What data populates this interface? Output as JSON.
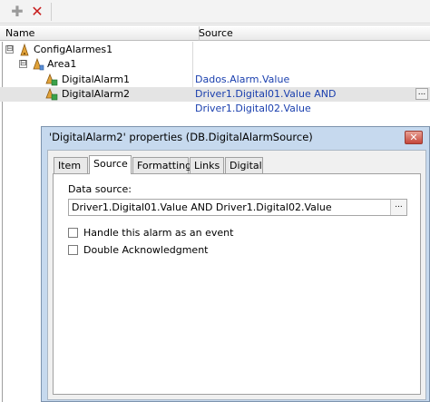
{
  "toolbar": {
    "add_icon": "plus-icon",
    "delete_icon": "red-x-delete-icon"
  },
  "tree": {
    "columns": {
      "name": "Name",
      "source": "Source"
    },
    "nodes": [
      {
        "name": "ConfigAlarmes1",
        "source": "",
        "expander": "⊟",
        "icon": "alarm-config-icon"
      },
      {
        "name": "Area1",
        "source": "",
        "expander": "⊟",
        "icon": "area-icon"
      },
      {
        "name": "DigitalAlarm1",
        "source": "Dados.Alarm.Value",
        "icon": "digital-alarm-icon"
      },
      {
        "name": "DigitalAlarm2",
        "source": "Driver1.Digital01.Value AND Driver1.Digital02.Value",
        "icon": "digital-alarm-icon",
        "selected": true,
        "button": "..."
      }
    ]
  },
  "dialog": {
    "title": "'DigitalAlarm2' properties (DB.DigitalAlarmSource)",
    "close_label": "✕",
    "tabs": [
      "Item",
      "Source",
      "Formatting",
      "Links",
      "Digital"
    ],
    "active_tab": "Source",
    "data_source_label": "Data source:",
    "data_source_value": "Driver1.Digital01.Value AND Driver1.Digital02.Value",
    "browse_button": "...",
    "checkboxes": [
      {
        "label": "Handle this alarm as an event",
        "checked": false
      },
      {
        "label": "Double Acknowledgment",
        "checked": false
      }
    ]
  }
}
